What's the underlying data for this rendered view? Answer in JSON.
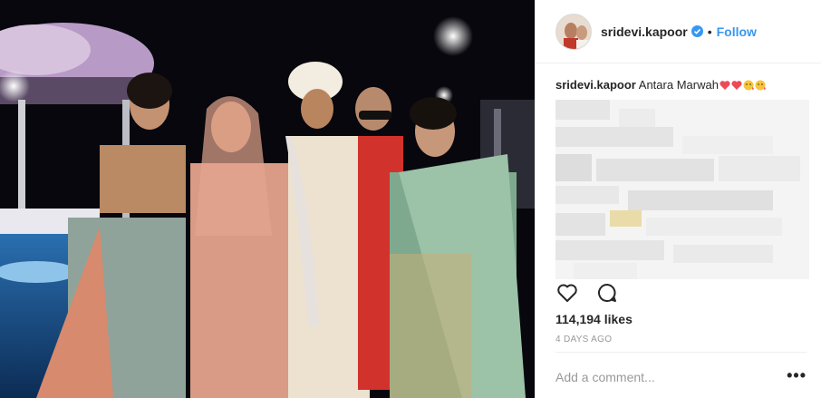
{
  "post": {
    "username": "sridevi.kapoor",
    "separator": "•",
    "follow_label": "Follow",
    "verified_icon": "verified-badge-icon",
    "caption": {
      "username": "sridevi.kapoor",
      "text": "Antara Marwah",
      "emojis": [
        "heart-emoji",
        "heart-emoji",
        "kiss-face-emoji",
        "kiss-face-emoji"
      ]
    },
    "likes": "114,194 likes",
    "timestamp": "4 DAYS AGO",
    "comment_placeholder": "Add a comment...",
    "more_label": "•••",
    "icons": {
      "like": "heart-outline-icon",
      "comment": "speech-bubble-icon"
    }
  },
  "colors": {
    "link": "#3897f0",
    "text": "#262626",
    "muted": "#999999",
    "heart": "#ed4956"
  }
}
